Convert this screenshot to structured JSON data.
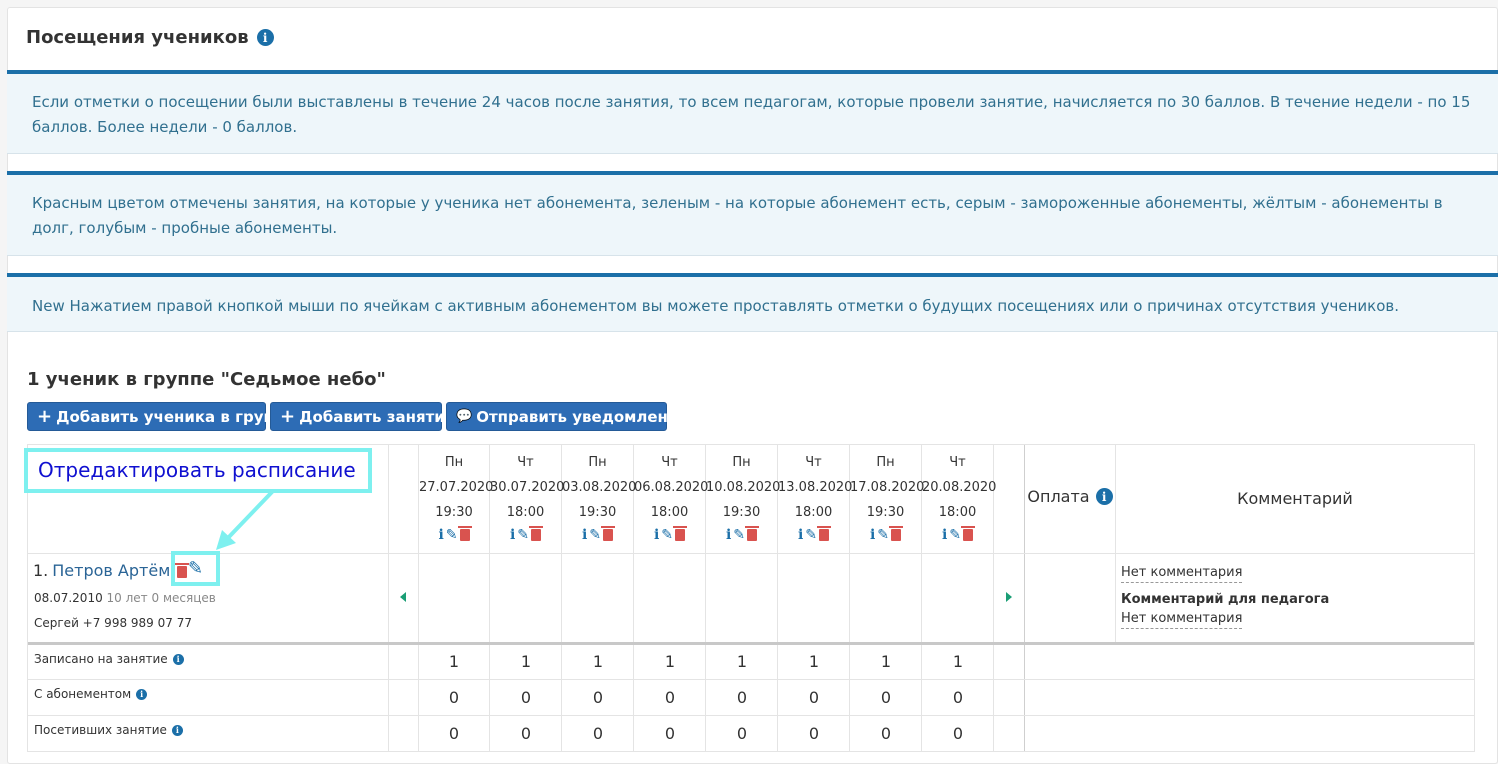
{
  "page": {
    "title": "Посещения учеников",
    "info_icon": "i"
  },
  "alerts": [
    "Если отметки о посещении были выставлены в течение 24 часов после занятия, то всем педагогам, которые провели занятие, начисляется по 30 баллов. В течение недели - по 15 баллов. Более недели - 0 баллов.",
    "Красным цветом отмечены занятия, на которые у ученика нет абонемента, зеленым - на которые абонемент есть, серым - замороженные абонементы, жёлтым - абонементы в долг, голубым - пробные абонементы.",
    "New Нажатием правой кнопкой мыши по ячейкам с активным абонементом вы можете проставлять отметки о будущих посещениях или о причинах отсутствия учеников."
  ],
  "group": {
    "title": "1 ученик в группе \"Седьмое небо\""
  },
  "buttons": {
    "add_student": "Добавить ученика в группу",
    "add_lesson": "Добавить занятие",
    "send_notification": "Отправить уведомление",
    "plus_icon": "+",
    "comment_icon": "💬"
  },
  "callout": {
    "text": "Отредактировать расписание"
  },
  "table": {
    "payment_header": "Оплата",
    "comment_header": "Комментарий",
    "lessons": [
      {
        "day": "Пн",
        "date": "27.07.2020",
        "time": "19:30"
      },
      {
        "day": "Чт",
        "date": "30.07.2020",
        "time": "18:00"
      },
      {
        "day": "Пн",
        "date": "03.08.2020",
        "time": "19:30"
      },
      {
        "day": "Чт",
        "date": "06.08.2020",
        "time": "18:00"
      },
      {
        "day": "Пн",
        "date": "10.08.2020",
        "time": "19:30"
      },
      {
        "day": "Чт",
        "date": "13.08.2020",
        "time": "18:00"
      },
      {
        "day": "Пн",
        "date": "17.08.2020",
        "time": "19:30"
      },
      {
        "day": "Чт",
        "date": "20.08.2020",
        "time": "18:00"
      }
    ],
    "student": {
      "number": "1.",
      "name": "Петров Артём",
      "birthdate": "08.07.2010",
      "age": "10 лет 0 месяцев",
      "contact": "Сергей +7 998 989 07 77"
    },
    "comments": {
      "no_comment": "Нет комментария",
      "teacher_label": "Комментарий для педагога",
      "teacher_no_comment": "Нет комментария"
    },
    "summary": [
      {
        "label": "Записано на занятие",
        "values": [
          "1",
          "1",
          "1",
          "1",
          "1",
          "1",
          "1",
          "1"
        ]
      },
      {
        "label": "С абонементом",
        "values": [
          "0",
          "0",
          "0",
          "0",
          "0",
          "0",
          "0",
          "0"
        ]
      },
      {
        "label": "Посетивших занятие",
        "values": [
          "0",
          "0",
          "0",
          "0",
          "0",
          "0",
          "0",
          "0"
        ]
      }
    ]
  },
  "colors": {
    "accent": "#1b6fa8",
    "button": "#2d6cb5",
    "alert_bg": "#eef6fa",
    "highlight": "#7ef0ef",
    "danger": "#d9534f"
  }
}
